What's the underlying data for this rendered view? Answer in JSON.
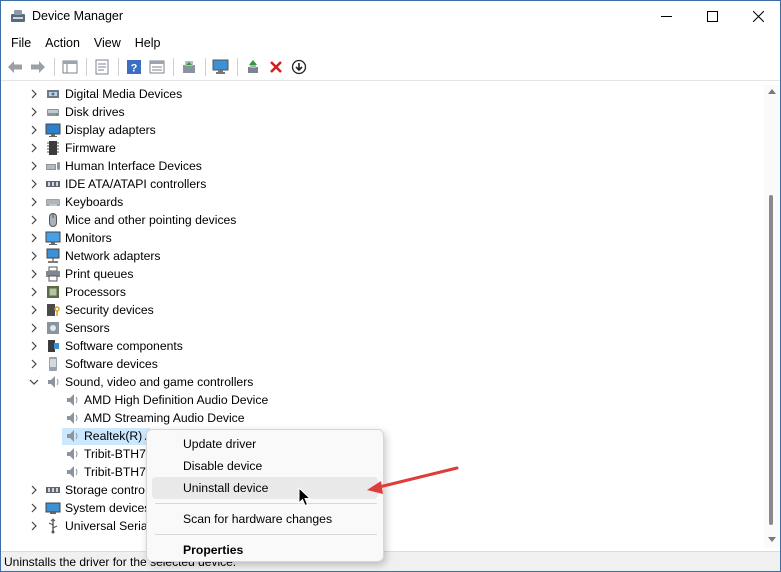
{
  "window": {
    "title": "Device Manager",
    "app_icon": "device-manager-icon"
  },
  "menubar": {
    "items": [
      "File",
      "Action",
      "View",
      "Help"
    ]
  },
  "toolbar": {
    "buttons": [
      "back-icon",
      "forward-icon",
      "console-tree-icon",
      "properties-icon",
      "help-icon",
      "view-icon",
      "update-driver-icon",
      "scan-hardware-icon",
      "enable-device-icon",
      "uninstall-icon",
      "download-icon"
    ]
  },
  "tree": {
    "categories": [
      {
        "label": "Digital Media Devices",
        "icon": "media-icon",
        "expanded": false
      },
      {
        "label": "Disk drives",
        "icon": "disk-icon",
        "expanded": false
      },
      {
        "label": "Display adapters",
        "icon": "display-icon",
        "expanded": false
      },
      {
        "label": "Firmware",
        "icon": "firmware-icon",
        "expanded": false
      },
      {
        "label": "Human Interface Devices",
        "icon": "hid-icon",
        "expanded": false
      },
      {
        "label": "IDE ATA/ATAPI controllers",
        "icon": "ide-icon",
        "expanded": false
      },
      {
        "label": "Keyboards",
        "icon": "keyboard-icon",
        "expanded": false
      },
      {
        "label": "Mice and other pointing devices",
        "icon": "mouse-icon",
        "expanded": false
      },
      {
        "label": "Monitors",
        "icon": "monitor-icon",
        "expanded": false
      },
      {
        "label": "Network adapters",
        "icon": "network-icon",
        "expanded": false
      },
      {
        "label": "Print queues",
        "icon": "printer-icon",
        "expanded": false
      },
      {
        "label": "Processors",
        "icon": "processor-icon",
        "expanded": false
      },
      {
        "label": "Security devices",
        "icon": "security-icon",
        "expanded": false
      },
      {
        "label": "Sensors",
        "icon": "sensor-icon",
        "expanded": false
      },
      {
        "label": "Software components",
        "icon": "software-component-icon",
        "expanded": false
      },
      {
        "label": "Software devices",
        "icon": "software-device-icon",
        "expanded": false
      },
      {
        "label": "Sound, video and game controllers",
        "icon": "speaker-icon",
        "expanded": true
      },
      {
        "label": "AMD High Definition Audio Device",
        "icon": "speaker-icon",
        "child": true
      },
      {
        "label": "AMD Streaming Audio Device",
        "icon": "speaker-icon",
        "child": true
      },
      {
        "label": "Realtek(R) A",
        "icon": "speaker-icon",
        "child": true,
        "selected": true
      },
      {
        "label": "Tribit-BTH7",
        "icon": "speaker-icon",
        "child": true
      },
      {
        "label": "Tribit-BTH7",
        "icon": "speaker-icon",
        "child": true
      },
      {
        "label": "Storage contro",
        "icon": "storage-icon",
        "expanded": false
      },
      {
        "label": "System devices",
        "icon": "system-icon",
        "expanded": false
      },
      {
        "label": "Universal Serial",
        "icon": "usb-icon",
        "expanded": false
      }
    ]
  },
  "context_menu": {
    "items": [
      {
        "label": "Update driver"
      },
      {
        "label": "Disable device"
      },
      {
        "label": "Uninstall device",
        "highlighted": true
      },
      {
        "label": "Scan for hardware changes"
      },
      {
        "label": "Properties",
        "bold": true
      }
    ]
  },
  "status": {
    "text": "Uninstalls the driver for the selected device."
  },
  "colors": {
    "selection": "#cce8ff",
    "annotation_arrow": "#e03c3c",
    "uninstall_red": "#d42020"
  }
}
